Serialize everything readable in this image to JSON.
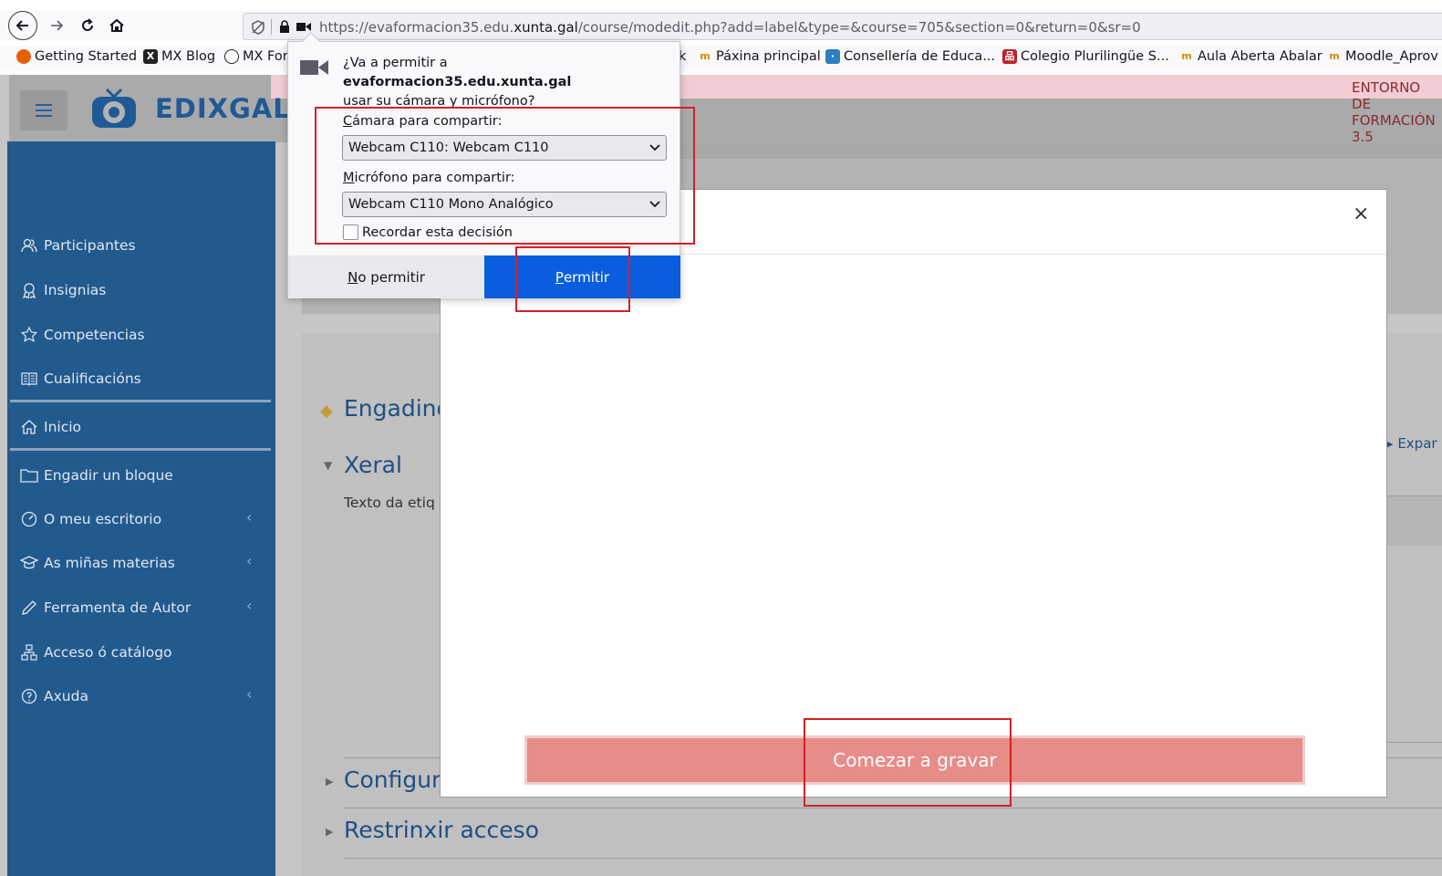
{
  "browser": {
    "url_prefix": "https://evaformacion35.edu.",
    "url_domain": "xunta.gal",
    "url_path": "/course/modedit.php?add=label&type=&course=705&section=0&return=0&sr=0",
    "bookmarks": [
      "Getting Started",
      "MX Blog",
      "MX For",
      "Páxina principal",
      "Consellería de Educa...",
      "Colegio Plurilingüe S...",
      "Aula Aberta Abalar",
      "Moodle_Aprov"
    ],
    "bookmark_partial": "k"
  },
  "header": {
    "logo_text": "EDIXGAL",
    "environment_label": "ENTORNO DE FORMACIÓN 3.5"
  },
  "sidebar": {
    "items": [
      {
        "label": "Participantes",
        "icon": "users-icon"
      },
      {
        "label": "Insignias",
        "icon": "badge-icon"
      },
      {
        "label": "Competencias",
        "icon": "star-icon"
      },
      {
        "label": "Cualificacións",
        "icon": "gradebook-icon"
      },
      {
        "label": "Inicio",
        "icon": "home-icon"
      },
      {
        "label": "Engadir un bloque",
        "icon": "folder-icon"
      },
      {
        "label": "O meu escritorio",
        "icon": "dashboard-icon"
      },
      {
        "label": "As miñas materias",
        "icon": "graduation-cap-icon"
      },
      {
        "label": "Ferramenta de Autor",
        "icon": "pencil-icon"
      },
      {
        "label": "Acceso ó catálogo",
        "icon": "sitemap-icon"
      },
      {
        "label": "Axuda",
        "icon": "help-icon"
      }
    ]
  },
  "page": {
    "heading_partial": "Engadind",
    "section_general": "Xeral",
    "label_text_partial": "Texto da etiq",
    "section_config_partial": "Configur",
    "section_restrict": "Restrinxir acceso",
    "expand_partial": "Expar"
  },
  "modal": {
    "close_label": "×",
    "record_button": "Comezar a gravar"
  },
  "permission_popup": {
    "question_prefix": "¿Va a permitir a ",
    "question_domain": "evaformacion35.edu.xunta.gal",
    "question_suffix": "usar su cámara y micrófono?",
    "camera_label_first": "C",
    "camera_label_rest": "ámara para compartir:",
    "camera_value": "Webcam C110: Webcam C110",
    "mic_label_first": "M",
    "mic_label_rest": "icrófono para compartir:",
    "mic_value": "Webcam C110 Mono Analógico",
    "remember_label": "Recordar esta decisión",
    "deny_first": "N",
    "deny_rest": "o permitir",
    "allow_first": "P",
    "allow_rest": "ermitir"
  },
  "colors": {
    "sidebar": "#225a8e",
    "allow_button": "#0a5ddf",
    "record_button": "#e68c89",
    "annotation": "#d42027"
  }
}
